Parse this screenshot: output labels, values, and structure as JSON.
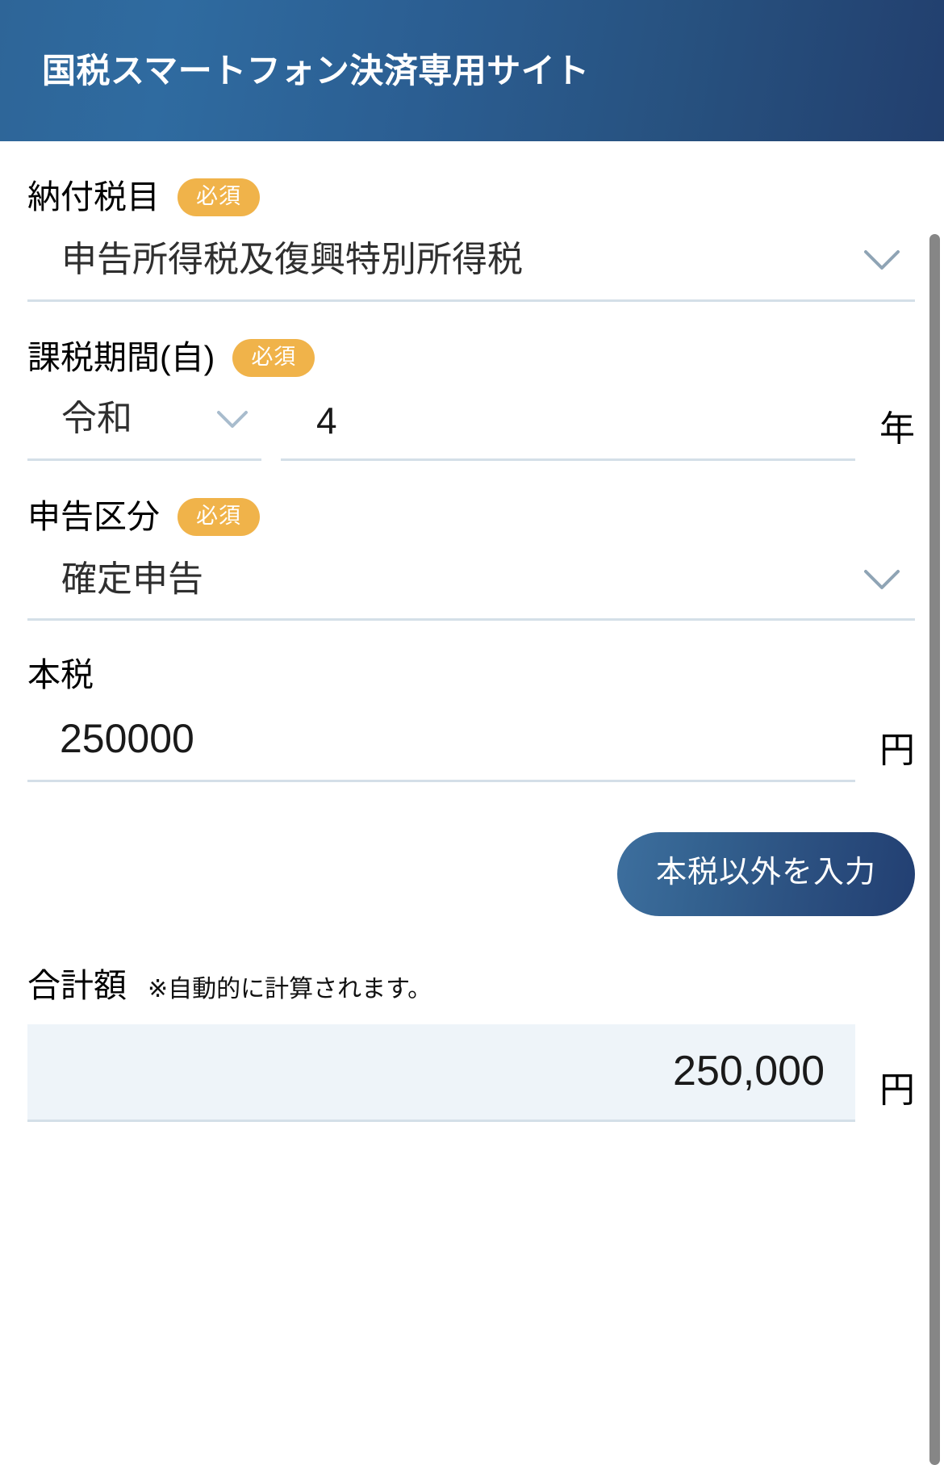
{
  "header": {
    "title": "国税スマートフォン決済専用サイト",
    "gradient_from": "#2e6598",
    "gradient_to": "#223f6e"
  },
  "badges": {
    "required_label": "必須",
    "required_color": "#f0b34a"
  },
  "fields": {
    "tax_item": {
      "label": "納付税目",
      "required": "必須",
      "value": "申告所得税及復興特別所得税",
      "chevron": "chevron-down-icon"
    },
    "taxable_period": {
      "label": "課税期間(自)",
      "required": "必須",
      "era_value": "令和",
      "era_chevron": "chevron-down-icon",
      "year_value": "4",
      "year_unit": "年"
    },
    "filing_type": {
      "label": "申告区分",
      "required": "必須",
      "value": "確定申告",
      "chevron": "chevron-down-icon"
    },
    "principal_tax": {
      "label": "本税",
      "value": "250000",
      "unit": "円"
    }
  },
  "actions": {
    "other_than_principal_label": "本税以外を入力",
    "button_gradient_from": "#3d6f9e",
    "button_gradient_to": "#223f72"
  },
  "total": {
    "label": "合計額",
    "note": "※自動的に計算されます。",
    "value": "250,000",
    "unit": "円",
    "box_color": "#eef4f9"
  }
}
